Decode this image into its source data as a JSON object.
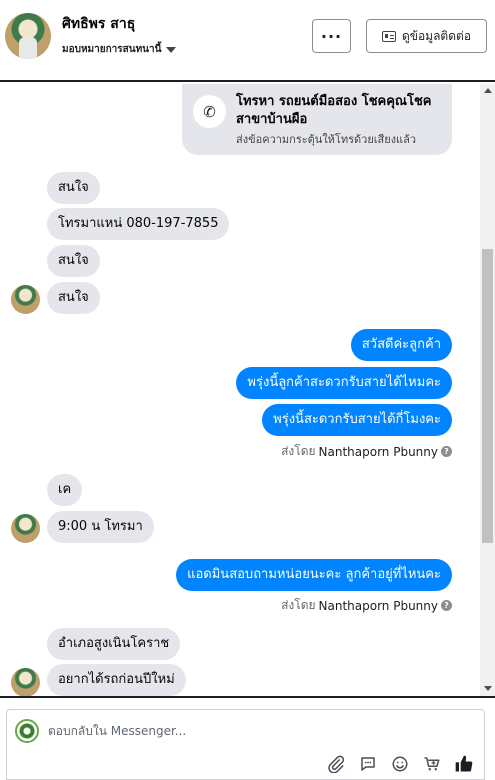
{
  "header": {
    "contact_name": "ศิทธิพร สาธุ",
    "assign_label": "มอบหมายการสนทนานี้",
    "more_label": "···",
    "view_info_label": "ดูข้อมูลติดต่อ"
  },
  "call_card": {
    "title": "โทรหา รถยนต์มือสอง โชคคุณโชค สาขาบ้านผือ",
    "subtitle": "ส่งข้อความกระตุ้นให้โทรด้วยเสียงแล้ว",
    "icon": "phone-icon"
  },
  "messages_block_1": [
    "สนใจ",
    "โทรมาแหน่ 080-197-7855",
    "สนใจ",
    "สนใจ"
  ],
  "outgoing_block_1": [
    "สวัสดีค่ะลูกค้า",
    "พรุ่งนี้ลูกค้าสะดวกรับสายได้ไหมคะ",
    "พรุ่งนี้สะดวกรับสายได้กี่โมงคะ"
  ],
  "sent_by_1": {
    "prefix": "ส่งโดย",
    "name": "Nanthaporn Pbunny",
    "help_icon": "?"
  },
  "messages_block_2": [
    "เค",
    "9:00 น โทรมา"
  ],
  "outgoing_block_2": [
    "แอดมินสอบถามหน่อยนะคะ ลูกค้าอยู่ที่ไหนคะ"
  ],
  "sent_by_2": {
    "prefix": "ส่งโดย",
    "name": "Nanthaporn Pbunny",
    "help_icon": "?"
  },
  "messages_block_3": [
    "อำเภอสูงเนินโคราช",
    "อยากได้รถก่อนปีใหม่"
  ],
  "composer": {
    "placeholder": "ตอบกลับใน Messenger...",
    "tools": [
      "attachment-icon",
      "saved-reply-icon",
      "emoji-icon",
      "cart-icon",
      "like-icon"
    ]
  },
  "colors": {
    "incoming_bubble": "#e4e6eb",
    "outgoing_bubble": "#0084ff",
    "scrollbar_thumb": "#c1c1c1"
  }
}
